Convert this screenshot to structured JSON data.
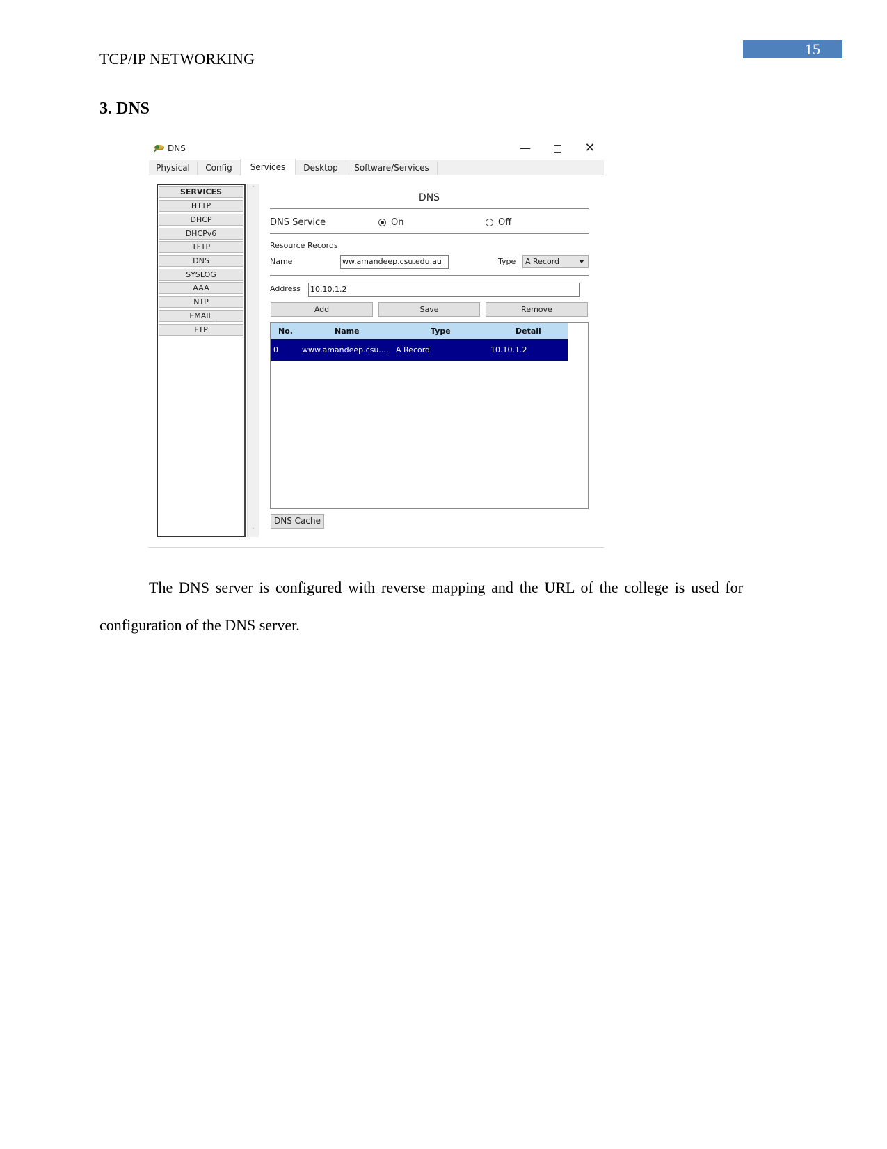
{
  "page": {
    "number": "15",
    "running_head": "TCP/IP NETWORKING",
    "section_title": "3. DNS",
    "body_paragraph": "The DNS server is configured with reverse mapping and the URL of the college is used for configuration of the DNS server.",
    "badge_color": "#4f81bd"
  },
  "window": {
    "title": "DNS",
    "icon": "server-device-icon",
    "controls": {
      "minimize": "—",
      "maximize": "□",
      "close": "✕"
    },
    "tabs": [
      {
        "label": "Physical",
        "active": false
      },
      {
        "label": "Config",
        "active": false
      },
      {
        "label": "Services",
        "active": true
      },
      {
        "label": "Desktop",
        "active": false
      },
      {
        "label": "Software/Services",
        "active": false
      }
    ],
    "services": {
      "header": "SERVICES",
      "items": [
        "HTTP",
        "DHCP",
        "DHCPv6",
        "TFTP",
        "DNS",
        "SYSLOG",
        "AAA",
        "NTP",
        "EMAIL",
        "FTP"
      ]
    },
    "dns": {
      "heading": "DNS",
      "service_label": "DNS Service",
      "on_label": "On",
      "off_label": "Off",
      "service_state": "On",
      "resource_records_label": "Resource Records",
      "name_label": "Name",
      "name_value": "ww.amandeep.csu.edu.au",
      "type_label": "Type",
      "type_value": "A Record",
      "address_label": "Address",
      "address_value": "10.10.1.2",
      "buttons": {
        "add": "Add",
        "save": "Save",
        "remove": "Remove",
        "dns_cache": "DNS Cache"
      },
      "table": {
        "columns": [
          "No.",
          "Name",
          "Type",
          "Detail"
        ],
        "rows": [
          {
            "no": "0",
            "name": "www.amandeep.csu....",
            "type": "A Record",
            "detail": "10.10.1.2",
            "selected": true
          }
        ],
        "header_color": "#bcdcf4",
        "selected_color": "#00008b"
      }
    }
  }
}
